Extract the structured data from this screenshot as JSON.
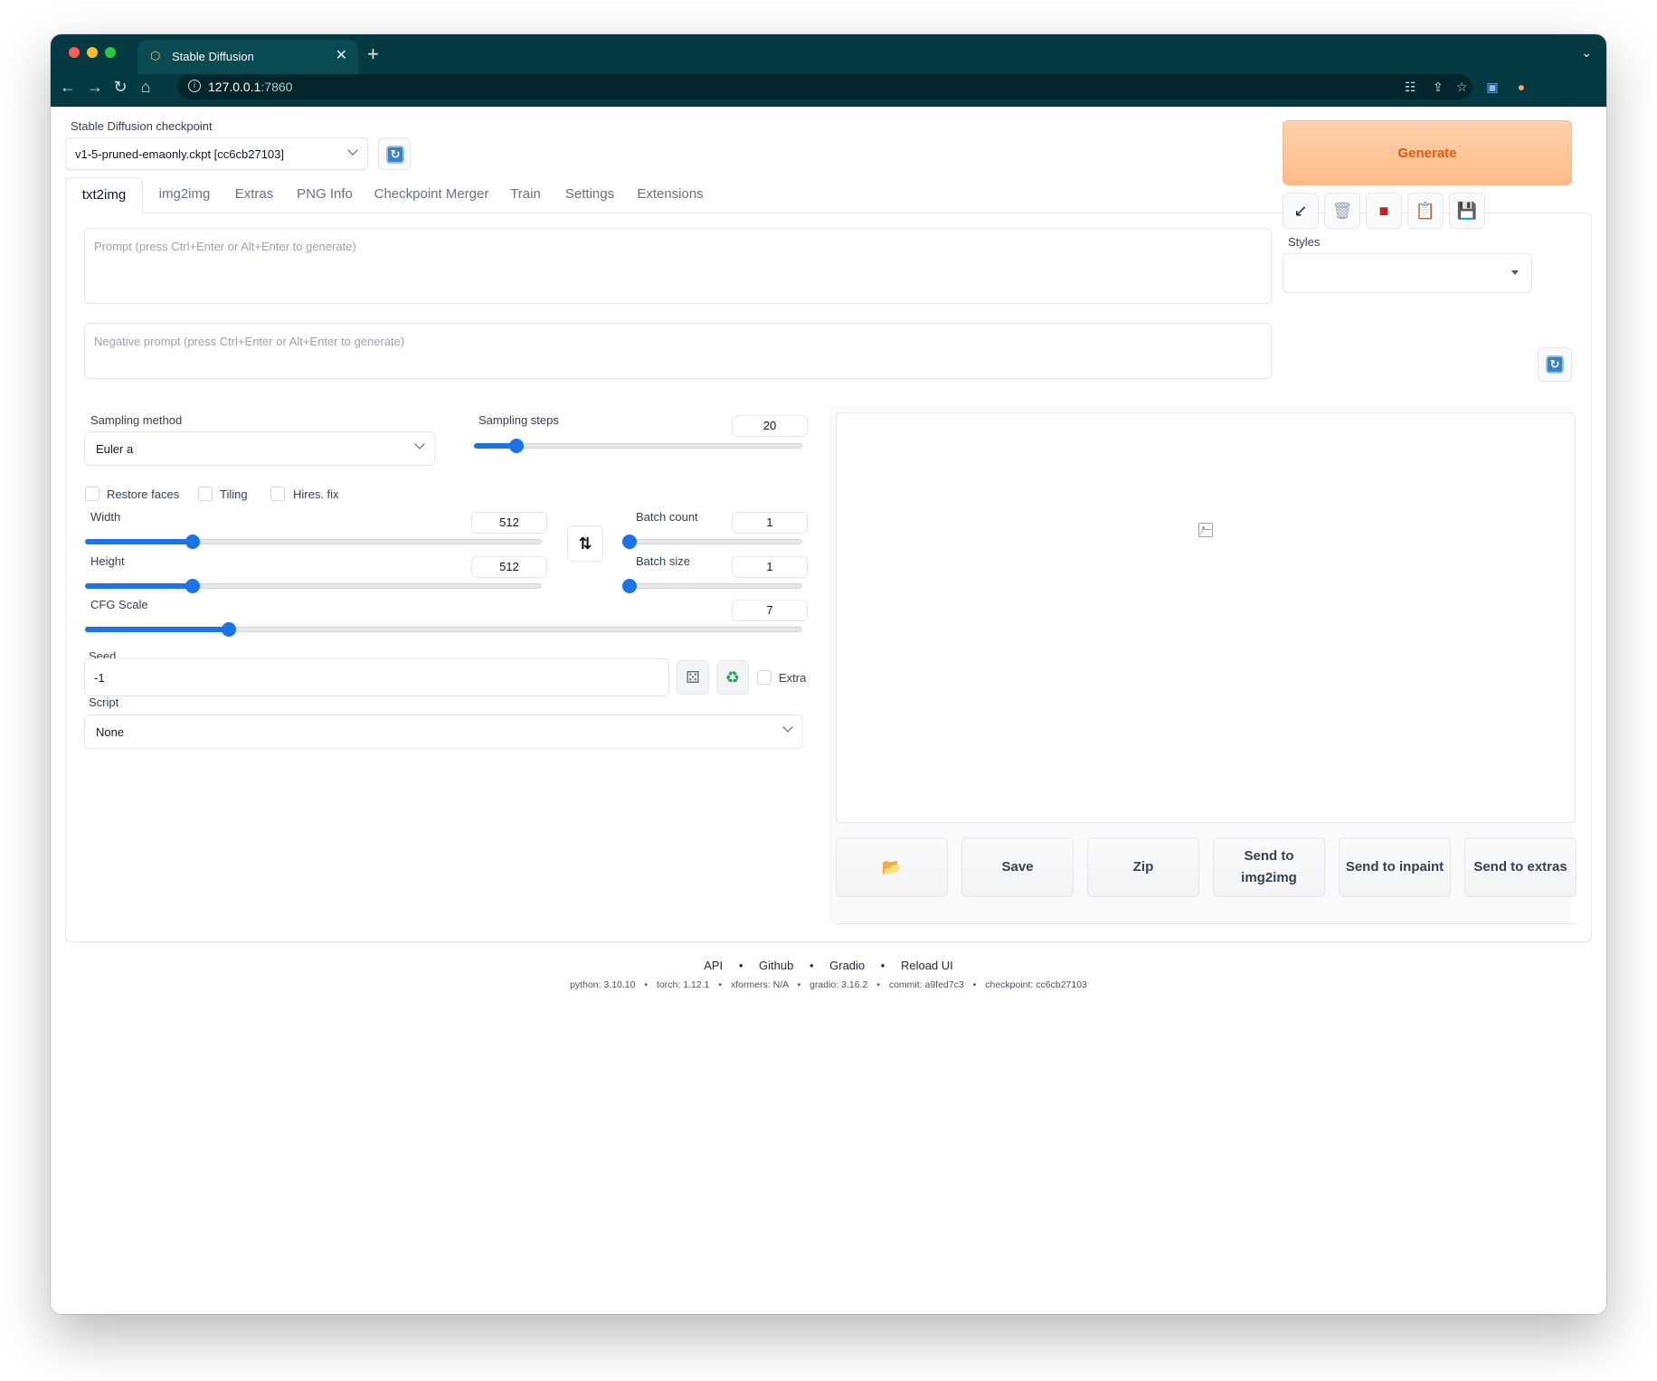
{
  "browser": {
    "tab_title": "Stable Diffusion",
    "url_host": "127.0.0.1",
    "url_port": ":7860"
  },
  "checkpoint": {
    "label": "Stable Diffusion checkpoint",
    "value": "v1-5-pruned-emaonly.ckpt [cc6cb27103]"
  },
  "tabs": [
    "txt2img",
    "img2img",
    "Extras",
    "PNG Info",
    "Checkpoint Merger",
    "Train",
    "Settings",
    "Extensions"
  ],
  "prompt": {
    "placeholder": "Prompt (press Ctrl+Enter or Alt+Enter to generate)"
  },
  "negative_prompt": {
    "placeholder": "Negative prompt (press Ctrl+Enter or Alt+Enter to generate)"
  },
  "generate": {
    "label": "Generate"
  },
  "styles": {
    "label": "Styles"
  },
  "sampling_method": {
    "label": "Sampling method",
    "value": "Euler a"
  },
  "sampling_steps": {
    "label": "Sampling steps",
    "value": "20",
    "fraction": 0.13
  },
  "checkboxes": {
    "restore_faces": "Restore faces",
    "tiling": "Tiling",
    "hires_fix": "Hires. fix"
  },
  "width": {
    "label": "Width",
    "value": "512",
    "fraction": 0.235
  },
  "height": {
    "label": "Height",
    "value": "512",
    "fraction": 0.235
  },
  "batch_count": {
    "label": "Batch count",
    "value": "1",
    "fraction": 0.0
  },
  "batch_size": {
    "label": "Batch size",
    "value": "1",
    "fraction": 0.0
  },
  "cfg_scale": {
    "label": "CFG Scale",
    "value": "7",
    "fraction": 0.2
  },
  "seed": {
    "label": "Seed",
    "value": "-1",
    "extra_label": "Extra"
  },
  "script": {
    "label": "Script",
    "value": "None"
  },
  "output_buttons": {
    "save": "Save",
    "zip": "Zip",
    "send_img2img_line1": "Send to",
    "send_img2img_line2": "img2img",
    "send_inpaint": "Send to inpaint",
    "send_extras": "Send to extras"
  },
  "footer": {
    "links": [
      "API",
      "Github",
      "Gradio",
      "Reload UI"
    ],
    "separator": "•",
    "versions": [
      "python: 3.10.10",
      "torch: 1.12.1",
      "xformers: N/A",
      "gradio: 3.16.2",
      "commit: a9fed7c3",
      "checkpoint: cc6cb27103"
    ]
  },
  "colors": {
    "accent": "#1a73e8",
    "generate_text": "#ea580c",
    "chrome": "#053a42"
  }
}
